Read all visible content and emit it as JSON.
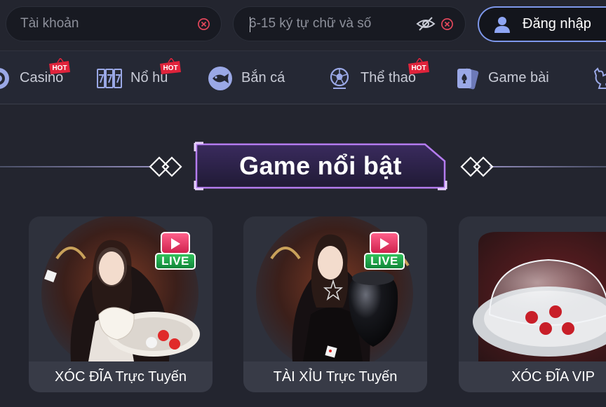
{
  "login": {
    "username_placeholder": "Tài khoản",
    "password_placeholder": "6-15 ký tự chữ và số",
    "login_label": "Đăng nhập"
  },
  "nav": {
    "items": [
      {
        "label": "Casino",
        "icon": "casino-chip-icon",
        "hot": true
      },
      {
        "label": "Nổ hũ",
        "icon": "slot-777-icon",
        "hot": true
      },
      {
        "label": "Bắn cá",
        "icon": "fish-icon",
        "hot": false
      },
      {
        "label": "Thể thao",
        "icon": "soccer-ball-icon",
        "hot": true
      },
      {
        "label": "Game bài",
        "icon": "playing-cards-icon",
        "hot": false
      },
      {
        "label": "",
        "icon": "rooster-icon",
        "hot": false
      }
    ],
    "hot_label": "HOT"
  },
  "section": {
    "title": "Game nổi bật"
  },
  "games": [
    {
      "name": "XÓC ĐĨA Trực Tuyến",
      "badge": "LIVE"
    },
    {
      "name": "TÀI XỈU Trực Tuyến",
      "badge": "LIVE"
    },
    {
      "name": "XÓC ĐĨA VIP",
      "badge": ""
    }
  ],
  "colors": {
    "background": "#23252f",
    "nav_background": "#252834",
    "login_border": "#7d97ea",
    "hot_badge": "#e0233b",
    "title_border": "#b57cf0",
    "live_green": "#1fa64a",
    "live_red": "#e4335f"
  }
}
